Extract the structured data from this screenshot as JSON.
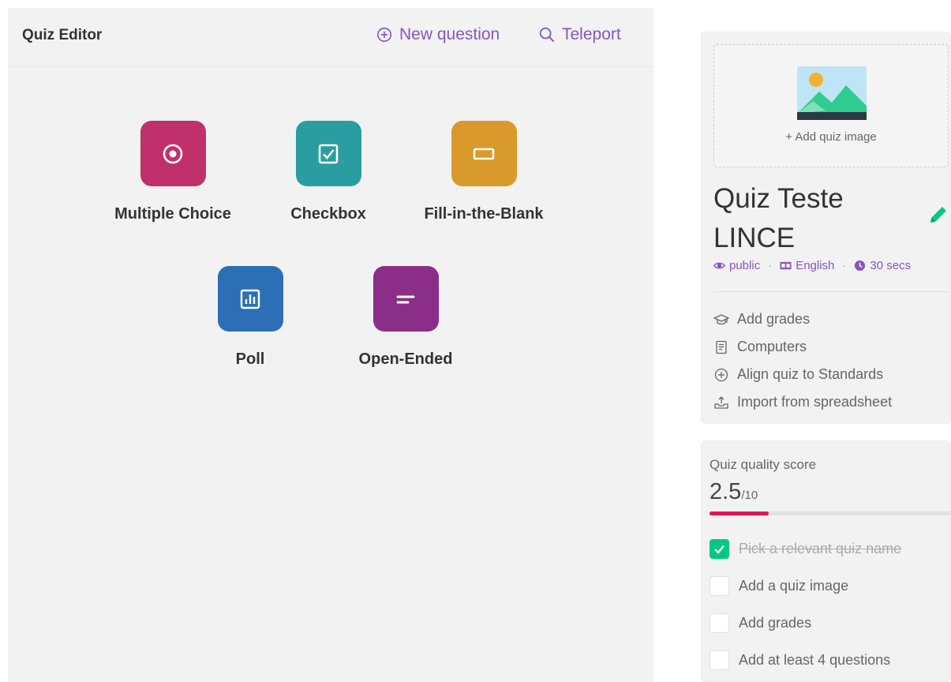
{
  "editor": {
    "title": "Quiz Editor",
    "new_question": "New question",
    "teleport": "Teleport"
  },
  "question_types": [
    {
      "label": "Multiple Choice",
      "color": "#c0306a",
      "icon": "radio-target-icon"
    },
    {
      "label": "Checkbox",
      "color": "#2a9da0",
      "icon": "checkbox-icon"
    },
    {
      "label": "Fill-in-the-Blank",
      "color": "#d99a2b",
      "icon": "blank-box-icon"
    },
    {
      "label": "Poll",
      "color": "#2c6fb4",
      "icon": "bar-chart-icon"
    },
    {
      "label": "Open-Ended",
      "color": "#8a2e8a",
      "icon": "text-lines-icon"
    }
  ],
  "quiz": {
    "add_image": "+ Add quiz image",
    "name": "Quiz Teste LINCE",
    "visibility": "public",
    "language": "English",
    "time": "30 secs",
    "accent_color": "#8854c0",
    "edit_color": "#00c985"
  },
  "side_actions": {
    "add_grades": "Add grades",
    "subject": "Computers",
    "align_standards": "Align quiz to Standards",
    "import_spreadsheet": "Import from spreadsheet"
  },
  "quality": {
    "title": "Quiz quality score",
    "score": "2.5",
    "max": "/10",
    "fill_fraction": 0.25,
    "bar_color": "#e2174f",
    "checks": [
      {
        "label": "Pick a relevant quiz name",
        "done": true
      },
      {
        "label": "Add a quiz image",
        "done": false
      },
      {
        "label": "Add grades",
        "done": false
      },
      {
        "label": "Add at least 4 questions",
        "done": false
      }
    ]
  }
}
